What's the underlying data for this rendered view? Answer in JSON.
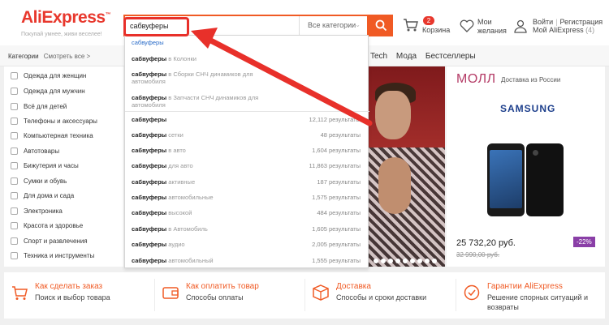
{
  "header": {
    "logo": "AliExpress",
    "tagline": "Покупай умнее, живи веселее!",
    "search_value": "сабвуферы",
    "category_select": "Все категории",
    "cart_count": "2",
    "cart_label": "Корзина",
    "wishlist_line1": "Мои",
    "wishlist_line2": "желания",
    "login": "Войти",
    "register": "Регистрация",
    "my_ali": "Мой AliExpress",
    "my_ali_count": "(4)"
  },
  "navbar": {
    "categories": "Категории",
    "see_all": "Смотреть все >",
    "links": [
      "Tech",
      "Мода",
      "Бестселлеры"
    ]
  },
  "sidebar": {
    "items": [
      "Одежда для женщин",
      "Одежда для мужчин",
      "Всё для детей",
      "Телефоны и аксессуары",
      "Компьютерная техника",
      "Автотовары",
      "Бижутерия и часы",
      "Сумки и обувь",
      "Для дома и сада",
      "Электроника",
      "Красота и здоровье",
      "Спорт и развлечения",
      "Техника и инструменты"
    ]
  },
  "suggestions": [
    {
      "q": "сабвуферы",
      "rest": "",
      "count": ""
    },
    {
      "q": "сабвуферы",
      "rest": " в Колонки",
      "count": ""
    },
    {
      "q": "сабвуферы",
      "rest": " в Сборки СНЧ динамиков для автомобиля",
      "count": ""
    },
    {
      "q": "сабвуферы",
      "rest": " в Запчасти СНЧ динамиков для автомобиля",
      "count": ""
    },
    {
      "q": "сабвуферы",
      "rest": "",
      "count": "12,112 результаты"
    },
    {
      "q": "сабвуферы",
      "rest": " сетки",
      "count": "48 результаты"
    },
    {
      "q": "сабвуферы",
      "rest": " в авто",
      "count": "1,604 результаты"
    },
    {
      "q": "сабвуферы",
      "rest": " для авто",
      "count": "11,863 результаты"
    },
    {
      "q": "сабвуферы",
      "rest": " активные",
      "count": "187 результаты"
    },
    {
      "q": "сабвуферы",
      "rest": " автомобильные",
      "count": "1,575 результаты"
    },
    {
      "q": "сабвуферы",
      "rest": " высокой",
      "count": "484 результаты"
    },
    {
      "q": "сабвуферы",
      "rest": " в Автомобиль",
      "count": "1,605 результаты"
    },
    {
      "q": "сабвуферы",
      "rest": " аудио",
      "count": "2,005 результаты"
    },
    {
      "q": "сабвуферы",
      "rest": " автомобильный",
      "count": "1,555 результаты"
    }
  ],
  "mall": {
    "title": "МОЛЛ",
    "subtitle": "Доставка из России",
    "brand": "SAMSUNG",
    "price": "25 732,20 руб.",
    "old_price": "32 990,00 руб.",
    "discount": "-22%"
  },
  "features": [
    {
      "title": "Как сделать заказ",
      "sub": "Поиск и выбор товара",
      "sub2": "",
      "icon": "cart-icon"
    },
    {
      "title": "Как оплатить товар",
      "sub": "Способы оплаты",
      "sub2": "",
      "icon": "wallet-icon"
    },
    {
      "title": "Доставка",
      "sub": "Способы и сроки доставки",
      "sub2": "",
      "icon": "delivery-icon"
    },
    {
      "title": "Гарантии AliExpress",
      "sub": "Решение спорных ситуаций и",
      "sub2": "возвраты",
      "icon": "guarantee-icon"
    }
  ],
  "colors": {
    "brand": "#e8382d",
    "accent": "#f05a24",
    "mall": "#b43b66",
    "highlight": "#e8302a"
  }
}
